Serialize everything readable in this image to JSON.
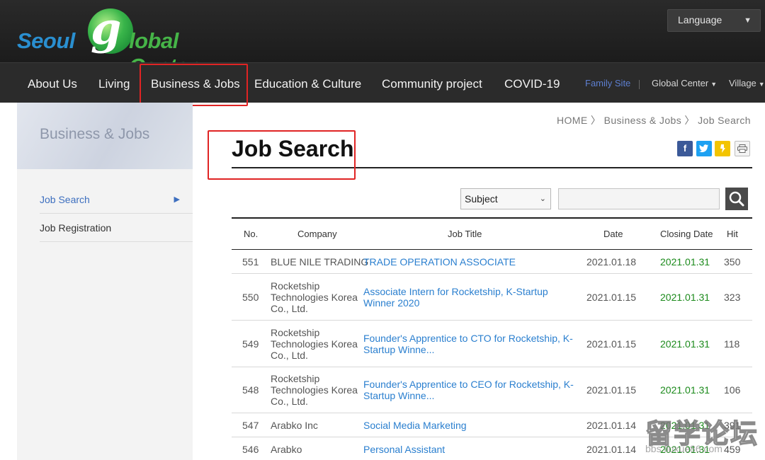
{
  "header": {
    "logo": {
      "seoul": "Seoul",
      "g": "g",
      "rest": "lobal Center"
    },
    "language_label": "Language"
  },
  "nav": {
    "items": [
      "About Us",
      "Living",
      "Business & Jobs",
      "Education & Culture",
      "Community project",
      "COVID-19"
    ],
    "utility": {
      "family_site": "Family Site",
      "global_center": "Global Center",
      "village": "Village"
    }
  },
  "sidebar": {
    "title": "Business & Jobs",
    "items": [
      "Job Search",
      "Job Registration"
    ]
  },
  "breadcrumb": {
    "home": "HOME",
    "section": "Business & Jobs",
    "page": "Job Search"
  },
  "page_title": "Job Search",
  "search": {
    "subject_label": "Subject"
  },
  "table": {
    "headers": {
      "no": "No.",
      "company": "Company",
      "job_title": "Job Title",
      "date": "Date",
      "closing": "Closing Date",
      "hit": "Hit"
    },
    "rows": [
      {
        "no": "551",
        "company": "BLUE NILE TRADING",
        "title": "TRADE OPERATION ASSOCIATE",
        "date": "2021.01.18",
        "closing": "2021.01.31",
        "hit": "350"
      },
      {
        "no": "550",
        "company": "Rocketship Technologies Korea Co., Ltd.",
        "title": "Associate Intern for Rocketship, K-Startup Winner 2020",
        "date": "2021.01.15",
        "closing": "2021.01.31",
        "hit": "323"
      },
      {
        "no": "549",
        "company": "Rocketship Technologies Korea Co., Ltd.",
        "title": "Founder's Apprentice to CTO for Rocketship, K-Startup Winne...",
        "date": "2021.01.15",
        "closing": "2021.01.31",
        "hit": "118"
      },
      {
        "no": "548",
        "company": "Rocketship Technologies Korea Co., Ltd.",
        "title": "Founder's Apprentice to CEO for Rocketship, K-Startup Winne...",
        "date": "2021.01.15",
        "closing": "2021.01.31",
        "hit": "106"
      },
      {
        "no": "547",
        "company": "Arabko Inc",
        "title": "Social Media Marketing",
        "date": "2021.01.14",
        "closing": "2021.01.31",
        "hit": "391"
      },
      {
        "no": "546",
        "company": "Arabko",
        "title": "Personal Assistant",
        "date": "2021.01.14",
        "closing": "2021.01.31",
        "hit": "459"
      }
    ]
  },
  "watermark": {
    "big": "留学论坛",
    "small": "bbs.liuxue86.com"
  },
  "colors": {
    "nav_bg": "#2b2b2b",
    "link_blue": "#2a7fcf",
    "closing_green": "#1b8a1b",
    "highlight_red": "#e02424"
  }
}
